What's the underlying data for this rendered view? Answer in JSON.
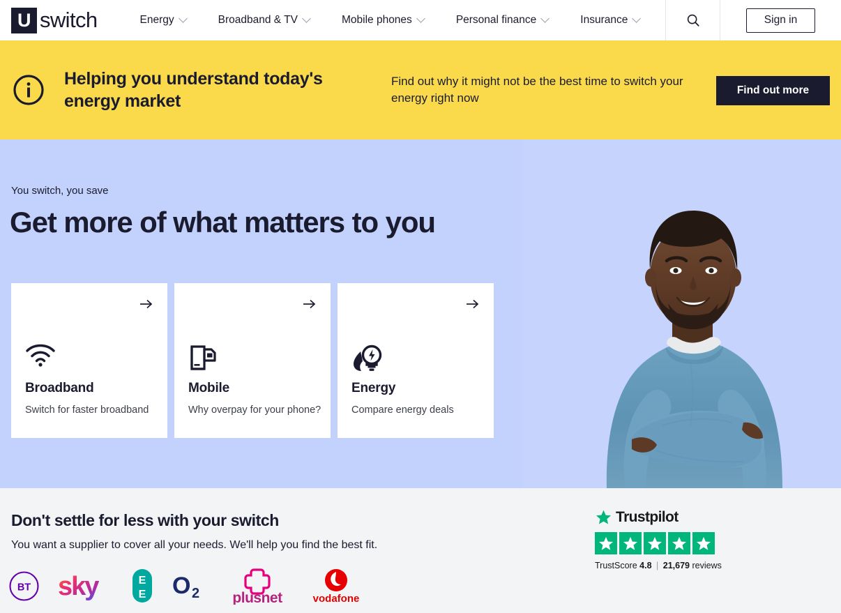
{
  "header": {
    "logo_mark": "U",
    "logo_word": "switch",
    "nav_items": [
      {
        "label": "Energy",
        "icon": "chevron-down-icon"
      },
      {
        "label": "Broadband & TV",
        "icon": "chevron-down-icon"
      },
      {
        "label": "Mobile phones",
        "icon": "chevron-down-icon"
      },
      {
        "label": "Personal finance",
        "icon": "chevron-down-icon"
      },
      {
        "label": "Insurance",
        "icon": "chevron-down-icon"
      }
    ],
    "search_icon": "search-icon",
    "signin_label": "Sign in"
  },
  "banner": {
    "icon": "info-circle-icon",
    "title": "Helping you understand today's energy market",
    "subtitle": "Find out why it might not be the best time to switch your energy right now",
    "cta_label": "Find out more",
    "background_color": "#fada4a",
    "cta_background_color": "#1b1b2f"
  },
  "hero": {
    "eyebrow": "You switch, you save",
    "title": "Get more of what matters to you",
    "background_color": "#c2d2fc",
    "photo_alt": "smiling-man-arms-crossed-photo",
    "cards": [
      {
        "icon": "wifi-icon",
        "arrow_icon": "arrow-right-icon",
        "title": "Broadband",
        "subtitle": "Switch for faster broadband"
      },
      {
        "icon": "sim-phone-icon",
        "arrow_icon": "arrow-right-icon",
        "title": "Mobile",
        "subtitle": "Why overpay for your phone?"
      },
      {
        "icon": "flame-bulb-icon",
        "arrow_icon": "arrow-right-icon",
        "title": "Energy",
        "subtitle": "Compare energy deals"
      }
    ]
  },
  "bottom": {
    "title": "Don't settle for less with your switch",
    "subtitle": "You want a supplier to cover all your needs. We'll help you find the best fit.",
    "background_color": "#f3f4f6",
    "brands": [
      {
        "name": "BT",
        "label": "BT",
        "color": "#6400aa"
      },
      {
        "name": "Sky",
        "label": "sky",
        "color": "#ea3e7b"
      },
      {
        "name": "EE",
        "label": "EE",
        "color": "#00a9a0"
      },
      {
        "name": "O2",
        "label": "O2",
        "color": "#1b2a6b"
      },
      {
        "name": "Plusnet",
        "label": "plusnet",
        "color": "#e6007e"
      },
      {
        "name": "Vodafone",
        "label": "vodafone",
        "color": "#e60000"
      }
    ]
  },
  "trustpilot": {
    "brand_name": "Trustpilot",
    "star_icon": "star-icon",
    "stars": 5,
    "star_color": "#00b67a",
    "score_prefix": "TrustScore",
    "score_value": "4.8",
    "separator": "|",
    "review_count": "21,679",
    "review_suffix": "reviews"
  }
}
